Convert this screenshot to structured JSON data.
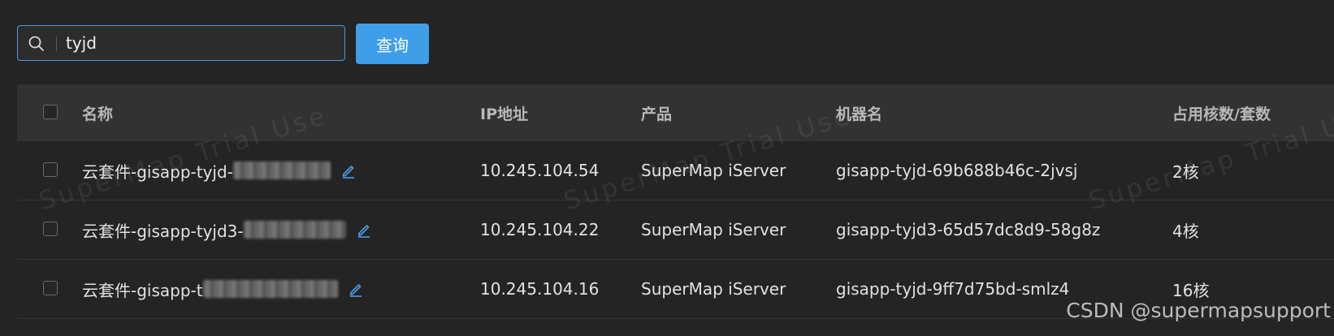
{
  "search": {
    "value": "tyjd",
    "button_label": "查询"
  },
  "table": {
    "headers": {
      "name": "名称",
      "ip": "IP地址",
      "product": "产品",
      "machine": "机器名",
      "cores": "占用核数/套数"
    },
    "rows": [
      {
        "name": "云套件-gisapp-tyjd-",
        "ip": "10.245.104.54",
        "product": "SuperMap iServer",
        "machine": "gisapp-tyjd-69b688b46c-2jvsj",
        "cores": "2核"
      },
      {
        "name": "云套件-gisapp-tyjd3-",
        "ip": "10.245.104.22",
        "product": "SuperMap iServer",
        "machine": "gisapp-tyjd3-65d57dc8d9-58g8z",
        "cores": "4核"
      },
      {
        "name": "云套件-gisapp-t",
        "ip": "10.245.104.16",
        "product": "SuperMap iServer",
        "machine": "gisapp-tyjd-9ff7d75bd-smlz4",
        "cores": "16核"
      }
    ]
  },
  "watermark": {
    "text": "SuperMap Trial Use"
  },
  "credit": "CSDN @supermapsupport",
  "colors": {
    "background": "#242424",
    "header_row": "#323232",
    "accent": "#409ee8"
  }
}
